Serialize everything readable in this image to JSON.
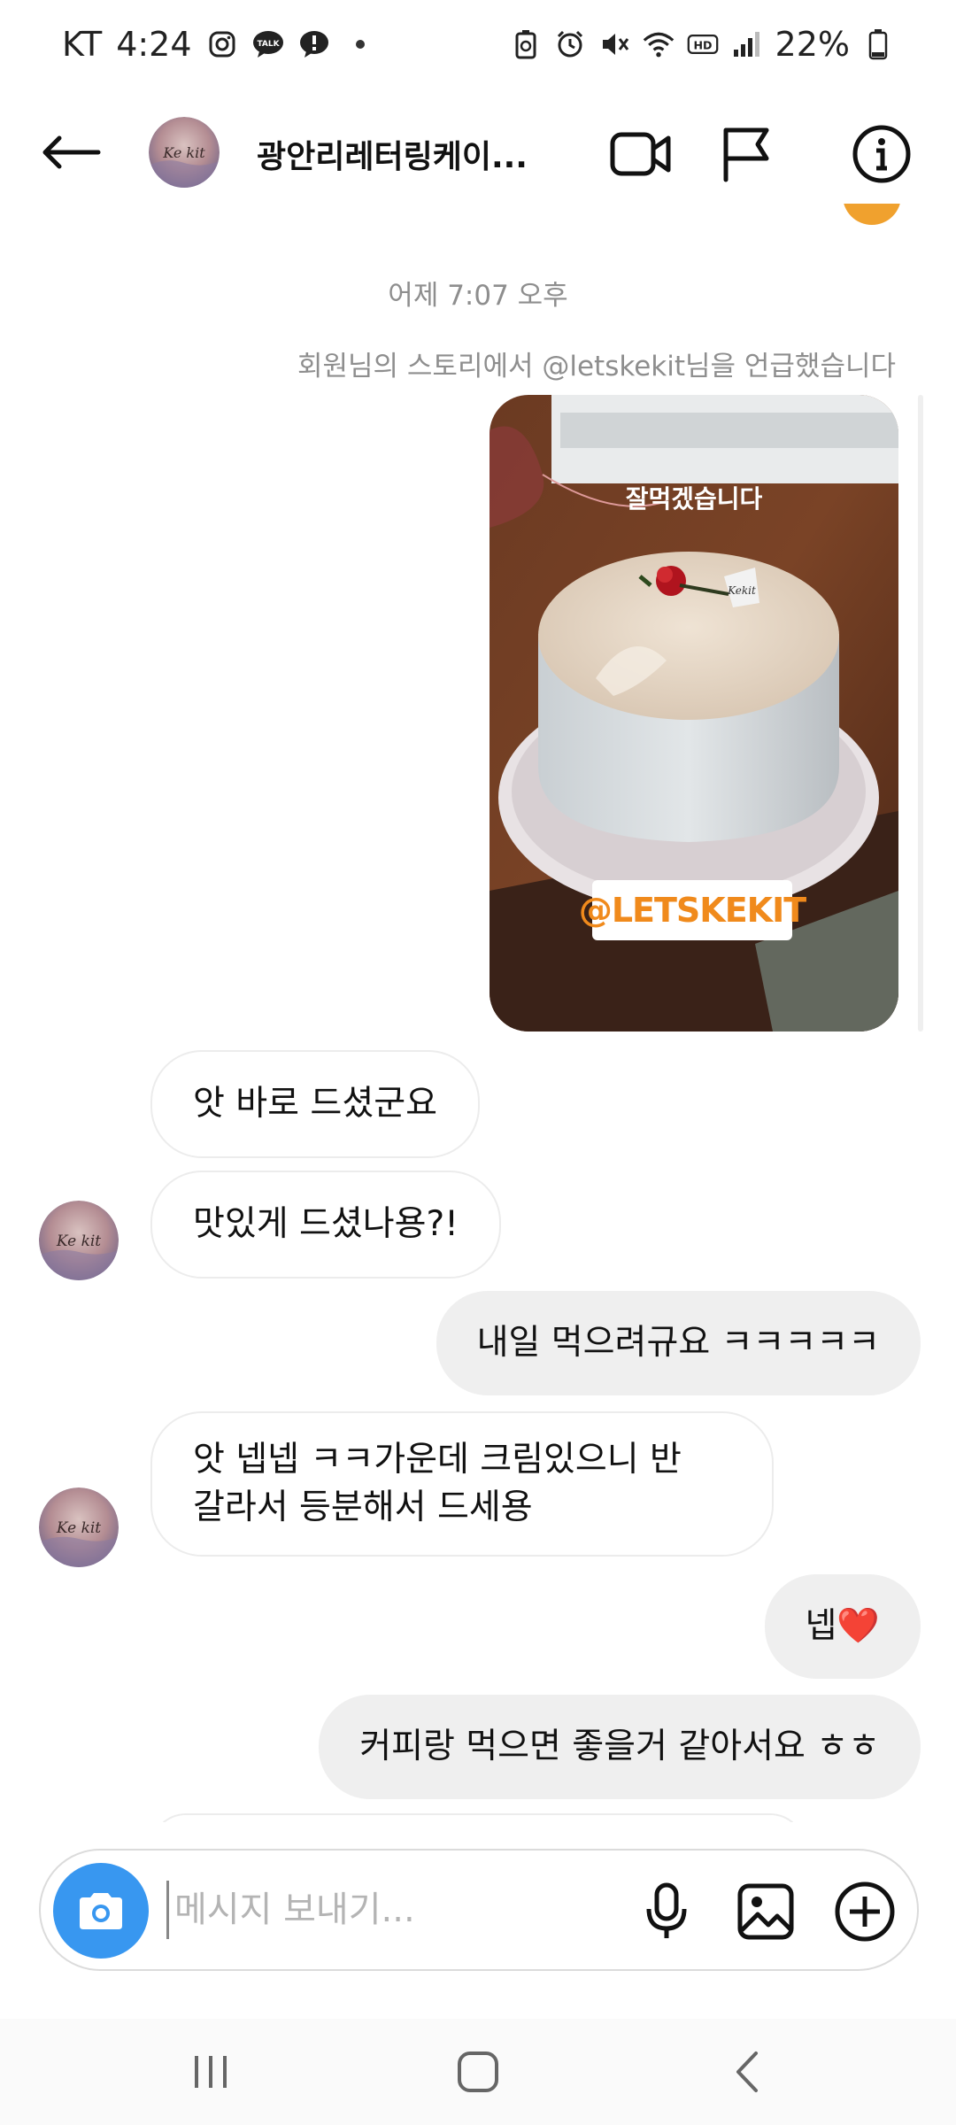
{
  "status_bar": {
    "carrier": "KT",
    "time": "4:24",
    "battery": "22%",
    "left_icons": [
      "instagram-icon",
      "kakaotalk-icon",
      "notice-icon",
      "dot-icon"
    ],
    "right_icons": [
      "battery-saver-icon",
      "alarm-icon",
      "mute-icon",
      "wifi-icon",
      "hd-icon",
      "signal-icon",
      "battery-icon"
    ]
  },
  "header": {
    "title": "광안리레터링케이...",
    "avatar_text": "Ke kit"
  },
  "chat": {
    "timestamp": "어제 7:07 오후",
    "mention_note": "회원님의 스토리에서 @letskekit님을 언급했습니다",
    "story": {
      "caption": "잘먹겠습니다",
      "tag": "@LETSKEKIT",
      "note_text": "Kekit"
    },
    "messages": [
      {
        "side": "in",
        "text": "앗 바로 드셨군요"
      },
      {
        "side": "in",
        "text": "맛있게 드셨나용?!"
      },
      {
        "side": "out",
        "text": "내일 먹으려규요 ㅋㅋㅋㅋㅋ"
      },
      {
        "side": "in",
        "text": "앗 넵넵 ㅋㅋ가운데 크림있으니 반",
        "text2": "갈라서 등분해서 드세용"
      },
      {
        "side": "out",
        "text": "넵❤️"
      },
      {
        "side": "out",
        "text": "커피랑 먹으면 좋을거 같아서요 ㅎㅎ"
      }
    ]
  },
  "composer": {
    "placeholder": "메시지 보내기..."
  },
  "colors": {
    "accent": "#3897f0",
    "tag_orange": "#f08a1c",
    "bubble_out": "#efefef",
    "muted_text": "#8e8e8e"
  }
}
